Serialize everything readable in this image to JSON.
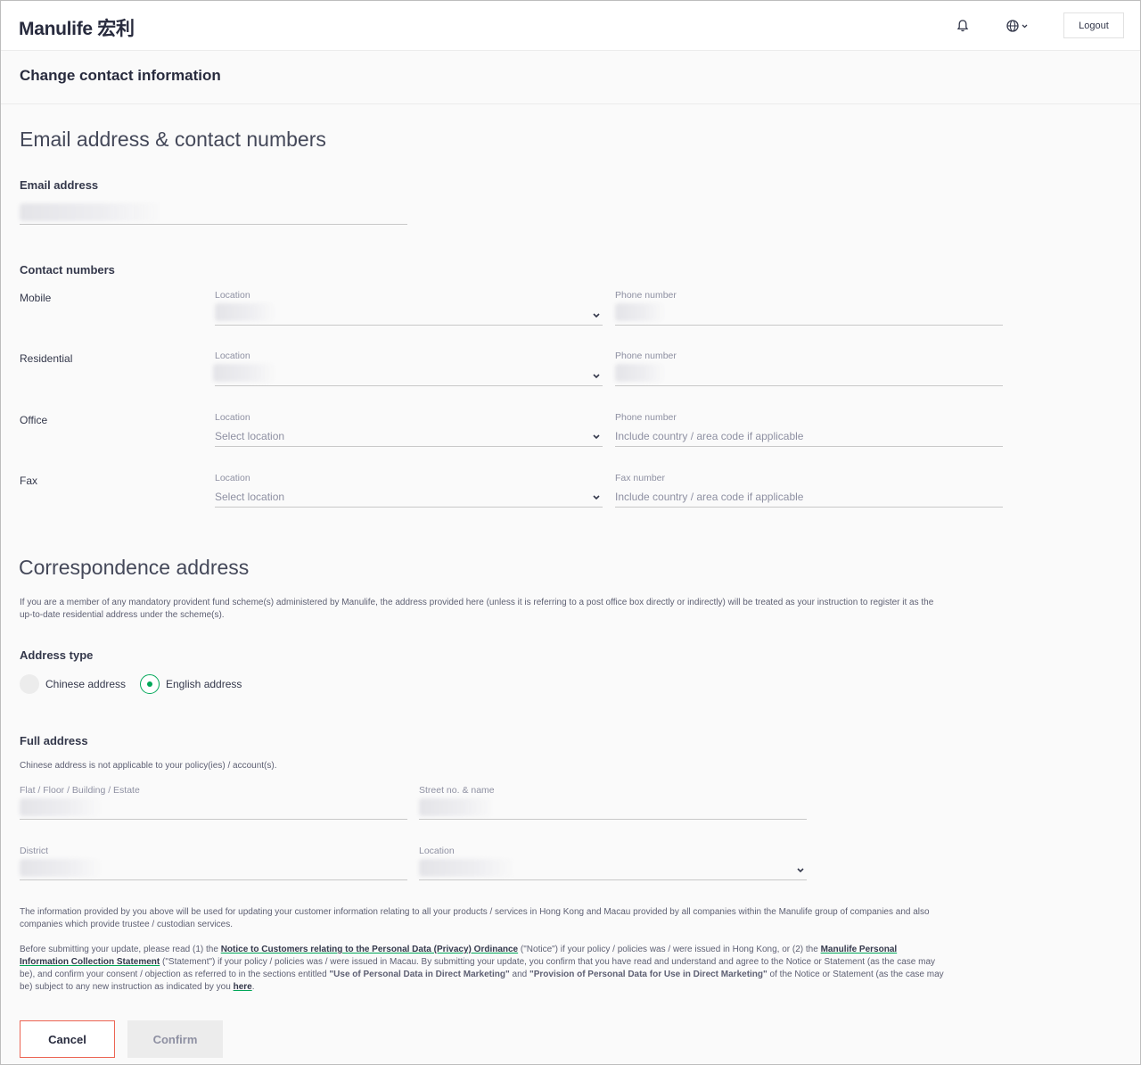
{
  "header": {
    "logo": "Manulife 宏利",
    "logout_label": "Logout"
  },
  "page": {
    "title": "Change contact information"
  },
  "contact_section": {
    "title": "Email address & contact numbers",
    "email_label": "Email address",
    "contact_numbers_label": "Contact numbers",
    "rows": [
      {
        "type": "Mobile",
        "location_label": "Location",
        "number_label": "Phone number",
        "location_placeholder": "",
        "number_placeholder": ""
      },
      {
        "type": "Residential",
        "location_label": "Location",
        "number_label": "Phone number",
        "location_placeholder": "",
        "number_placeholder": ""
      },
      {
        "type": "Office",
        "location_label": "Location",
        "number_label": "Phone number",
        "location_placeholder": "Select location",
        "number_placeholder": "Include country / area code if applicable"
      },
      {
        "type": "Fax",
        "location_label": "Location",
        "number_label": "Fax number",
        "location_placeholder": "Select location",
        "number_placeholder": "Include country / area code if applicable"
      }
    ]
  },
  "address_section": {
    "title": "Correspondence address",
    "notice": "If you are a member of any mandatory provident fund scheme(s) administered by Manulife, the address provided here (unless it is referring to a post office box directly or indirectly) will be treated as your instruction to register it as the up-to-date residential address under the scheme(s).",
    "address_type_label": "Address type",
    "options": [
      "Chinese address",
      "English address"
    ],
    "selected_option": "English address",
    "full_address_label": "Full address",
    "full_address_note": "Chinese address is not applicable to your policy(ies) / account(s).",
    "fields": {
      "flat": "Flat / Floor / Building / Estate",
      "street": "Street no. & name",
      "district": "District",
      "location": "Location"
    }
  },
  "footer_notes": {
    "info_text": "The information provided by you above will be used for updating your customer information relating to all your products / services in Hong Kong and Macau provided by all companies within the Manulife group of companies and also companies which provide trustee / custodian services.",
    "p2_a": "Before submitting your update, please read (1) the ",
    "link_notice": "Notice to Customers relating to the Personal Data (Privacy) Ordinance",
    "p2_b": " (\"Notice\") if your policy / policies was / were issued in Hong Kong, or (2) the ",
    "link_statement": "Manulife Personal Information Collection Statement",
    "p2_c": " (\"Statement\") if your policy / policies was / were issued in Macau. By submitting your update, you confirm that you have read and understand and agree to the Notice or Statement (as the case may be), and confirm your consent / objection as referred to in the sections entitled ",
    "bold_1": "\"Use of Personal Data in Direct Marketing\"",
    "p2_d": " and ",
    "bold_2": "\"Provision of Personal Data for Use in Direct Marketing\"",
    "p2_e": " of the Notice or Statement (as the case may be) subject to any new instruction as indicated by you ",
    "link_here": "here",
    "p2_f": "."
  },
  "actions": {
    "cancel_label": "Cancel",
    "confirm_label": "Confirm"
  },
  "colors": {
    "accent_green": "#00a758",
    "cancel_border": "#ec6453",
    "text_dark": "#282b3e"
  }
}
